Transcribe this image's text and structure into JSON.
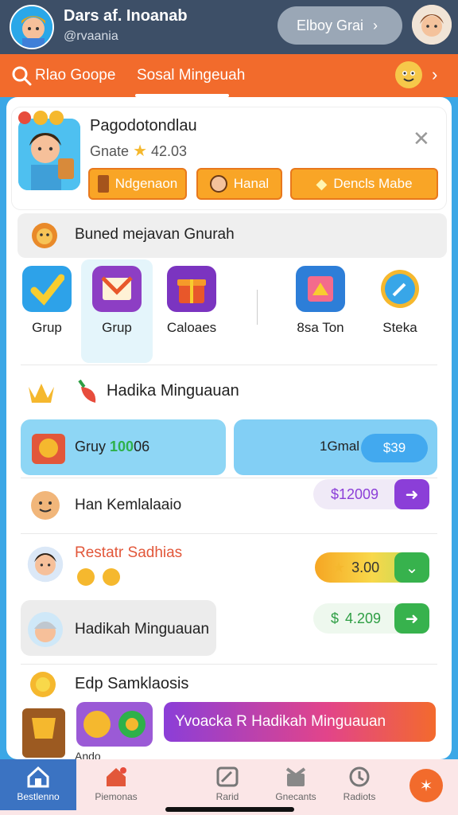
{
  "header": {
    "username": "Dars af. Inoanab",
    "handle": "@rvaania",
    "button_label": "Elboy Grai"
  },
  "nav": {
    "tab_search": "Rlao Goope",
    "tab_active": "Sosal Mingeuah"
  },
  "profile": {
    "name": "Pagodotondlau",
    "score_label": "Gnate",
    "score_value": "42.03",
    "pills": [
      "Ndgenaon",
      "Hanal",
      "Dencls Mabe"
    ]
  },
  "section": {
    "title": "Buned mejavan Gnurah"
  },
  "grid": [
    {
      "label": "Grup"
    },
    {
      "label": "Grup"
    },
    {
      "label": "Caloaes"
    },
    {
      "label": "8sa Ton"
    },
    {
      "label": "Steka"
    }
  ],
  "weekly": {
    "title": "Hadika Minguauan"
  },
  "cards": {
    "left_label": "Gruy",
    "left_highlight": "100",
    "left_suffix": "06",
    "right_label": "1Gmal",
    "right_chip": "$39"
  },
  "rows": [
    {
      "label": "Han Kemlalaaio",
      "value": "$12009"
    },
    {
      "label": "Restatr Sadhias",
      "value": "3.00"
    },
    {
      "label": "Hadikah Minguauan",
      "value": "4.209"
    }
  ],
  "footer_section": {
    "title": "Edp Samklaosis",
    "sub": "Ando",
    "cta": "Yvoacka R Hadikah Minguauan"
  },
  "bottom_nav": [
    {
      "label": "Bestlenno"
    },
    {
      "label": "Piemonas"
    },
    {
      "label": "Rarid"
    },
    {
      "label": "Gnecants"
    },
    {
      "label": "Radiots"
    }
  ],
  "colors": {
    "header": "#3d4f67",
    "orange": "#f26b2c",
    "accent_blue": "#3ba7e6",
    "purple": "#8b3ed8",
    "green": "#37b24d"
  }
}
